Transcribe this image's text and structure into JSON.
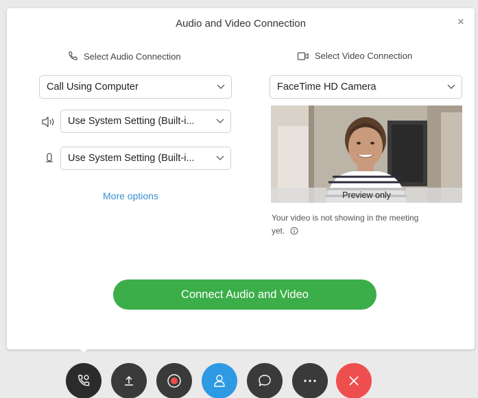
{
  "dialog": {
    "title": "Audio and Video Connection",
    "close_glyph": "×"
  },
  "audio": {
    "section_label": "Select Audio Connection",
    "section_icon": "phone-icon",
    "connection_value": "Call Using Computer",
    "speaker_value": "Use System Setting (Built-i...",
    "microphone_value": "Use System Setting (Built-i...",
    "more_options": "More options"
  },
  "video": {
    "section_label": "Select Video Connection",
    "section_icon": "video-camera-icon",
    "camera_value": "FaceTime HD Camera",
    "preview_label": "Preview only",
    "notice": "Your video is not showing in the meeting yet."
  },
  "connect_button_label": "Connect Audio and Video",
  "colors": {
    "connect_green": "#3cae49",
    "link_blue": "#3a8fd0",
    "participants_blue": "#2f9ae4",
    "leave_red": "#ef4e4e",
    "toolbar_dark": "#333333"
  },
  "toolbar": [
    {
      "name": "audio-connection",
      "icon": "phone-settings-icon"
    },
    {
      "name": "share",
      "icon": "upload-icon"
    },
    {
      "name": "record",
      "icon": "record-icon"
    },
    {
      "name": "participants",
      "icon": "participants-icon"
    },
    {
      "name": "chat",
      "icon": "chat-icon"
    },
    {
      "name": "more",
      "icon": "more-icon"
    },
    {
      "name": "leave",
      "icon": "close-icon"
    }
  ]
}
